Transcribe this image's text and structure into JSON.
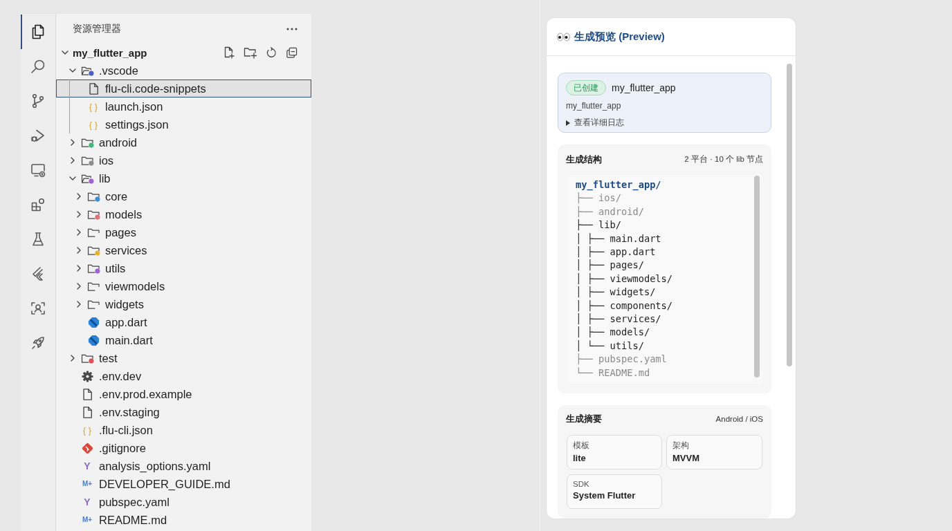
{
  "activity_bar": [
    {
      "kind": "files",
      "selected": true
    },
    {
      "kind": "search",
      "selected": false
    },
    {
      "kind": "source_control",
      "selected": false
    },
    {
      "kind": "run_debug",
      "selected": false
    },
    {
      "kind": "remote",
      "selected": false
    },
    {
      "kind": "extensions",
      "selected": false
    },
    {
      "kind": "testing",
      "selected": false
    },
    {
      "kind": "flutter",
      "selected": false
    },
    {
      "kind": "scan",
      "selected": false
    },
    {
      "kind": "rocket",
      "selected": false
    }
  ],
  "explorer": {
    "title": "资源管理器",
    "root": {
      "name": "my_flutter_app",
      "expanded": true,
      "selected": false,
      "children": [
        {
          "name": ".vscode",
          "kind": "folder",
          "color": "#4a5fc1",
          "expanded": true,
          "selected": false,
          "children": [
            {
              "name": "flu-cli.code-snippets",
              "kind": "file",
              "selected": true
            },
            {
              "name": "launch.json",
              "kind": "json",
              "glyph": "{ }",
              "selected": false
            },
            {
              "name": "settings.json",
              "kind": "json",
              "glyph": "{ }",
              "selected": false
            }
          ]
        },
        {
          "name": "android",
          "kind": "folder",
          "color": "#3fb97a",
          "expanded": false,
          "selected": false
        },
        {
          "name": "ios",
          "kind": "folder",
          "color": "#8e8e8e",
          "expanded": false,
          "selected": false
        },
        {
          "name": "lib",
          "kind": "folder",
          "color": "#a35fd6",
          "expanded": true,
          "selected": false,
          "children": [
            {
              "name": "core",
              "kind": "folder",
              "color": "#3a8fd6",
              "expanded": false,
              "selected": false
            },
            {
              "name": "models",
              "kind": "folder",
              "color": "#e0707a",
              "expanded": false,
              "selected": false
            },
            {
              "name": "pages",
              "kind": "folder",
              "expanded": false,
              "selected": false
            },
            {
              "name": "services",
              "kind": "folder",
              "color": "#e9b32c",
              "expanded": false,
              "selected": false
            },
            {
              "name": "utils",
              "kind": "folder",
              "color": "#a35fd6",
              "expanded": false,
              "selected": false
            },
            {
              "name": "viewmodels",
              "kind": "folder",
              "expanded": false,
              "selected": false
            },
            {
              "name": "widgets",
              "kind": "folder",
              "expanded": false,
              "selected": false
            },
            {
              "name": "app.dart",
              "kind": "dart",
              "selected": false
            },
            {
              "name": "main.dart",
              "kind": "dart",
              "selected": false
            }
          ]
        },
        {
          "name": "test",
          "kind": "folder",
          "color": "#e0505a",
          "expanded": false,
          "selected": false
        },
        {
          "name": ".env.dev",
          "kind": "config",
          "selected": false
        },
        {
          "name": ".env.prod.example",
          "kind": "file",
          "selected": false
        },
        {
          "name": ".env.staging",
          "kind": "file",
          "selected": false
        },
        {
          "name": ".flu-cli.json",
          "kind": "json",
          "glyph": "{ }",
          "selected": false
        },
        {
          "name": ".gitignore",
          "kind": "git",
          "selected": false
        },
        {
          "name": "analysis_options.yaml",
          "kind": "yaml",
          "glyph": "Y",
          "selected": false
        },
        {
          "name": "DEVELOPER_GUIDE.md",
          "kind": "markdown",
          "glyph": "M+",
          "selected": false
        },
        {
          "name": "pubspec.yaml",
          "kind": "yaml",
          "glyph": "Y",
          "selected": false
        },
        {
          "name": "README.md",
          "kind": "markdown",
          "glyph": "M+",
          "selected": false
        }
      ]
    }
  },
  "preview": {
    "title": "生成预览 (Preview)",
    "status": {
      "badge": "已创建",
      "kind": "success",
      "name": "my_flutter_app",
      "subtitle": "my_flutter_app",
      "log_toggle": {
        "label": "查看详细日志",
        "expanded": false
      }
    },
    "structure": {
      "title": "生成结构",
      "meta": "2 平台 · 10 个 lib 节点",
      "lines": [
        {
          "text": "my_flutter_app/",
          "kind": "root"
        },
        {
          "text": "├── ios/",
          "kind": "dim"
        },
        {
          "text": "├── android/",
          "kind": "dim"
        },
        {
          "text": "├── lib/",
          "kind": "normal"
        },
        {
          "text": "│ ├── main.dart",
          "kind": "normal"
        },
        {
          "text": "│ ├── app.dart",
          "kind": "normal"
        },
        {
          "text": "│ ├── pages/",
          "kind": "normal"
        },
        {
          "text": "│ ├── viewmodels/",
          "kind": "normal"
        },
        {
          "text": "│ ├── widgets/",
          "kind": "normal"
        },
        {
          "text": "│ ├── components/",
          "kind": "normal"
        },
        {
          "text": "│ ├── services/",
          "kind": "normal"
        },
        {
          "text": "│ ├── models/",
          "kind": "normal"
        },
        {
          "text": "│ └── utils/",
          "kind": "normal"
        },
        {
          "text": "├── pubspec.yaml",
          "kind": "dim"
        },
        {
          "text": "└── README.md",
          "kind": "dim"
        }
      ]
    },
    "summary": {
      "title": "生成摘要",
      "meta": "Android / iOS",
      "items": [
        {
          "label": "模板",
          "value": "lite"
        },
        {
          "label": "架构",
          "value": "MVVM"
        },
        {
          "label": "SDK",
          "value": "System Flutter"
        }
      ]
    }
  }
}
